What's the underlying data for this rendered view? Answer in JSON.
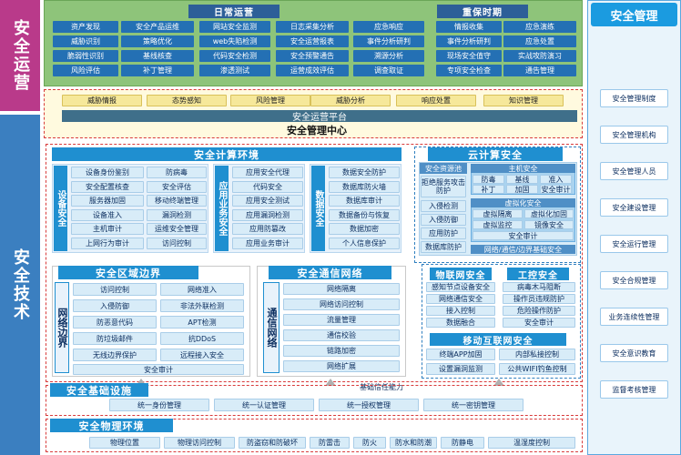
{
  "left_labels": {
    "ops": "安全运营",
    "tech": "安全技术"
  },
  "ops": {
    "daily_title": "日常运营",
    "keep_title": "重保时期",
    "daily_cols": [
      [
        "资产发现",
        "威胁识别",
        "脆弱性识别",
        "风险评估"
      ],
      [
        "安全产品运维",
        "策略优化",
        "基线核查",
        "补丁管理"
      ],
      [
        "网站安全监测",
        "web失陷检测",
        "代码安全检测",
        "渗透测试"
      ],
      [
        "日志采集分析",
        "安全运营报表",
        "安全预警通告",
        "运营成效评估"
      ],
      [
        "应急响应",
        "事件分析研判",
        "溯源分析",
        "调查取证"
      ]
    ],
    "keep_cols": [
      [
        "情报收集",
        "事件分析研判",
        "现场安全值守",
        "专项安全检查"
      ],
      [
        "应急演练",
        "应急处置",
        "实战攻防演习",
        "通告管理"
      ]
    ]
  },
  "center": {
    "items": [
      "威胁情报",
      "态势感知",
      "风险管理",
      "威胁分析",
      "响应处置",
      "知识管理"
    ],
    "platform": "安全运营平台",
    "title": "安全管理中心"
  },
  "mgmt": {
    "title": "安全管理",
    "items": [
      "安全管理制度",
      "安全管理机构",
      "安全管理人员",
      "安全建设管理",
      "安全运行管理",
      "安全合规管理",
      "业务连续性管理",
      "安全意识教育",
      "监督考核管理"
    ]
  },
  "compute": {
    "title": "安全计算环境",
    "device_label": "设备安全",
    "device_col1": [
      "设备身份鉴别",
      "安全配置核查",
      "服务器加固",
      "设备准入",
      "主机审计",
      "上网行为审计"
    ],
    "device_col2": [
      "防病毒",
      "安全评估",
      "移动终端管理",
      "漏洞检测",
      "运维安全管理",
      "访问控制"
    ],
    "app_label": "应用业务安全",
    "app_items": [
      "应用安全代理",
      "代码安全",
      "应用安全测试",
      "应用漏洞检测",
      "应用防篡改",
      "应用业务审计"
    ],
    "data_label": "数据安全",
    "data_items": [
      "数据安全防护",
      "数据库防火墙",
      "数据库审计",
      "数据备份与恢复",
      "数据加密",
      "个人信息保护"
    ]
  },
  "cloud": {
    "title": "云计算安全",
    "res_title": "安全资源池",
    "res_items": [
      "拒绝服务攻击防护",
      "入侵检测",
      "入侵防御",
      "应用防护",
      "数据库防护"
    ],
    "host_title": "主机安全",
    "host_items": [
      "防毒",
      "基线",
      "准入",
      "补丁",
      "加固",
      "安全审计"
    ],
    "virt_title": "虚拟化安全",
    "virt_items": [
      "虚拟隔离",
      "虚拟化加固",
      "虚拟监控",
      "镜像安全",
      "安全审计"
    ],
    "net_label": "网络/通信/边界基础安全"
  },
  "boundary": {
    "title": "安全区域边界",
    "label": "网络边界",
    "col1": [
      "访问控制",
      "入侵防御",
      "防恶意代码",
      "防垃圾邮件",
      "无线边界保护"
    ],
    "col2": [
      "网络准入",
      "非法外联检测",
      "APT检测",
      "抗DDoS",
      "远程接入安全"
    ],
    "audit": "安全审计"
  },
  "comm": {
    "title": "安全通信网络",
    "label": "通信网络",
    "items": [
      "网络隔离",
      "网络访问控制",
      "流量管理",
      "通信校验",
      "链路加密",
      "网络扩展"
    ]
  },
  "iot": {
    "title": "物联网安全",
    "col1": [
      "感知节点设备安全",
      "网络通信安全",
      "接入控制",
      "数据融合"
    ],
    "col2": []
  },
  "ics": {
    "title": "工控安全",
    "items": [
      "病毒木马阻断",
      "操作员违规防护",
      "危险操作防护",
      "安全审计"
    ]
  },
  "mobile": {
    "title": "移动互联网安全",
    "items": [
      "终端APP加固",
      "内部私接控制",
      "设置漏洞监测",
      "公共WIFI钓鱼控制"
    ]
  },
  "infra": {
    "title": "安全基础设施",
    "capability": "基础信任能力",
    "items": [
      "统一身份管理",
      "统一认证管理",
      "统一授权管理",
      "统一密钥管理"
    ]
  },
  "physical": {
    "title": "安全物理环境",
    "items": [
      "物理位置",
      "物理访问控制",
      "防盗窃和防破坏",
      "防雷击",
      "防火",
      "防水和防潮",
      "防静电",
      "温湿度控制"
    ]
  }
}
